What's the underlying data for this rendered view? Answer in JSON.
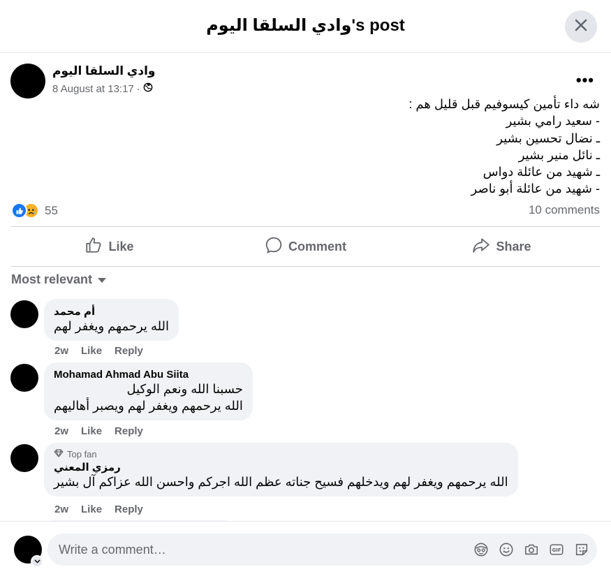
{
  "header": {
    "title": "وادي السلقا اليوم's post"
  },
  "post": {
    "author": "وادي السلقا اليوم",
    "date": "8 August at 13:17",
    "separator": "·",
    "more_label": "•••",
    "lines": [
      "شه داء تأمين كيسوفيم قبل قليل هم :",
      "- سعيد رامي بشير",
      "ـ نضال تحسين بشير",
      "ـ نائل منير بشير",
      "ـ شهيد من عائلة دواس",
      "- شهيد من عائلة أبو ناصر"
    ],
    "reaction_count": "55",
    "comment_count": "10 comments"
  },
  "actions": {
    "like": "Like",
    "comment": "Comment",
    "share": "Share"
  },
  "sort": {
    "label": "Most relevant"
  },
  "comments": [
    {
      "name": "أم محمد",
      "lines": [
        "الله يرحمهم ويغفر لهم"
      ],
      "time": "2w",
      "like": "Like",
      "reply": "Reply"
    },
    {
      "name": "Mohamad Ahmad Abu Siita",
      "lines": [
        "حسبنا الله ونعم الوكيل",
        "الله يرحمهم ويغفر لهم ويصبر أهاليهم"
      ],
      "time": "2w",
      "like": "Like",
      "reply": "Reply"
    },
    {
      "badge": "Top fan",
      "name": "رمزي المعني",
      "lines": [
        "الله يرحمهم ويغفر لهم ويدخلهم فسيح جناته عظم الله اجركم واحسن الله عزاكم آل بشير"
      ],
      "time": "2w",
      "like": "Like",
      "reply": "Reply"
    }
  ],
  "composer": {
    "placeholder": "Write a comment…",
    "gif_label": "GIF"
  },
  "colors": {
    "like_blue": "#1877f2",
    "sad_yellow": "#f7b125",
    "secondary_text": "#65676b",
    "bubble_bg": "#f0f2f5"
  }
}
